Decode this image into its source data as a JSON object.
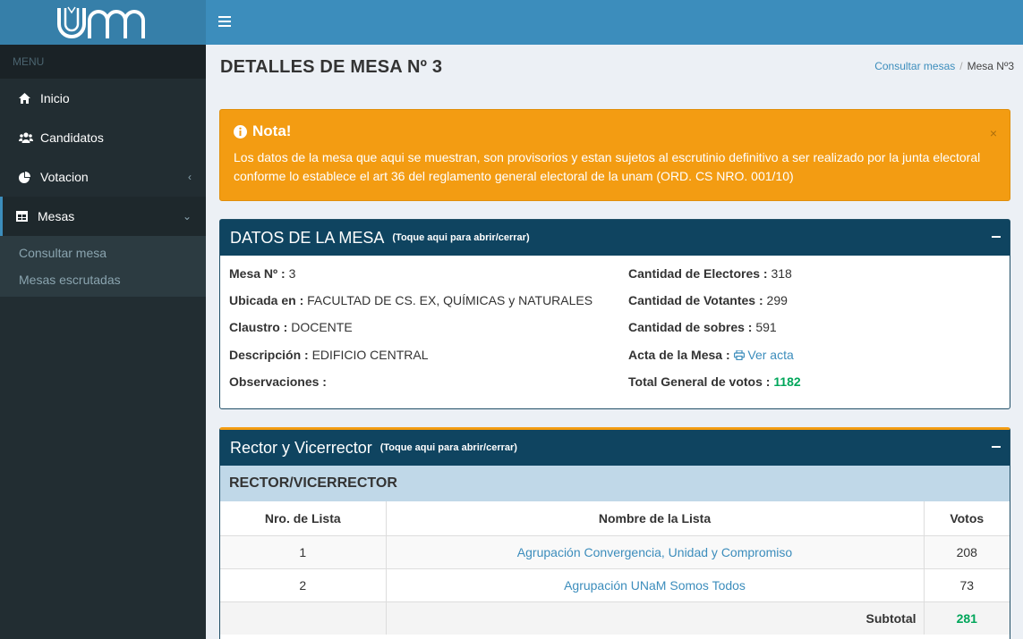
{
  "sidebar": {
    "logo_text": "UNaM",
    "menu_header": "MENU",
    "items": [
      {
        "label": "Inicio",
        "icon": "home-icon"
      },
      {
        "label": "Candidatos",
        "icon": "users-icon"
      },
      {
        "label": "Votacion",
        "icon": "pie-chart-icon",
        "chevron": "‹"
      },
      {
        "label": "Mesas",
        "icon": "table-icon",
        "chevron": "⌄"
      }
    ],
    "subitems": [
      "Consultar mesa",
      "Mesas escrutadas"
    ]
  },
  "page": {
    "title": "DETALLES DE MESA Nº 3",
    "breadcrumb": {
      "link": "Consultar mesas",
      "sep": "/",
      "current": "Mesa Nº3"
    }
  },
  "alert": {
    "title": "Nota!",
    "text": "Los datos de la mesa que aqui se muestran, son provisorios y estan sujetos al escrutinio definitivo a ser realizado por la junta electoral conforme lo establece el art 36 del reglamento general electoral de la unam (ORD. CS NRO. 001/10)",
    "close": "×"
  },
  "datos": {
    "title": "DATOS DE LA MESA",
    "subtitle": "(Toque aqui para abrir/cerrar)",
    "mesa_label": "Mesa Nº :",
    "mesa_value": "3",
    "ubicada_label": "Ubicada en :",
    "ubicada_value": "FACULTAD DE CS. EX, QUÍMICAS y NATURALES",
    "claustro_label": "Claustro :",
    "claustro_value": "DOCENTE",
    "descripcion_label": "Descripción :",
    "descripcion_value": "EDIFICIO CENTRAL",
    "observaciones_label": "Observaciones :",
    "electores_label": "Cantidad de Electores :",
    "electores_value": "318",
    "votantes_label": "Cantidad de Votantes :",
    "votantes_value": "299",
    "sobres_label": "Cantidad de sobres :",
    "sobres_value": "591",
    "acta_label": "Acta de la Mesa :",
    "acta_link": "Ver acta",
    "total_label": "Total General de votos :",
    "total_value": "1182"
  },
  "rector": {
    "title": "Rector y Vicerrector",
    "subtitle": "(Toque aqui para abrir/cerrar)",
    "section": "RECTOR/VICERRECTOR",
    "headers": [
      "Nro. de Lista",
      "Nombre de la Lista",
      "Votos"
    ],
    "rows": [
      {
        "nro": "1",
        "nombre": "Agrupación Convergencia, Unidad y Compromiso",
        "votos": "208"
      },
      {
        "nro": "2",
        "nombre": "Agrupación UNaM Somos Todos",
        "votos": "73"
      }
    ],
    "subtotal_label": "Subtotal",
    "subtotal_value": "281"
  },
  "colors": {
    "sidebar": "#222d32",
    "topbar": "#3c8dbc",
    "alert": "#f39c12",
    "box_header": "#0f4460",
    "green": "#00a65a"
  }
}
